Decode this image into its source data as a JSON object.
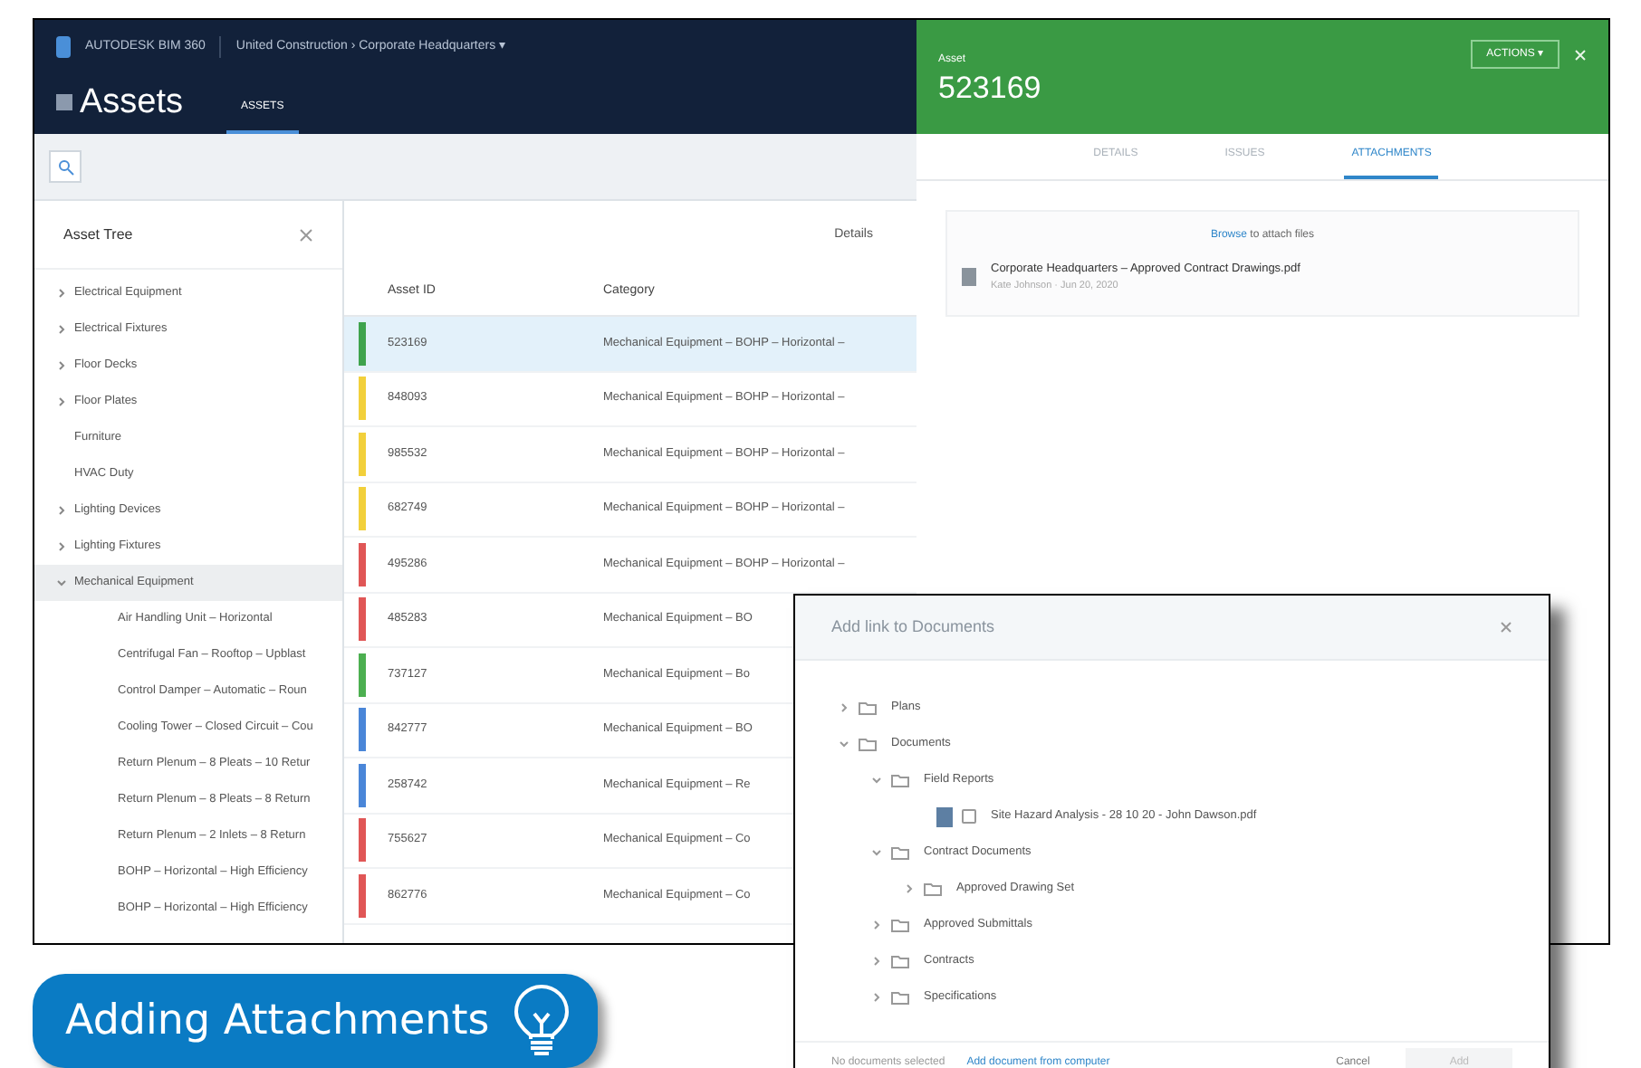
{
  "header": {
    "brand": "AUTODESK BIM 360",
    "breadcrumb": "United Construction › Corporate Headquarters ▾",
    "title": "Assets",
    "tabs": [
      {
        "label": "ASSETS",
        "selected": true
      }
    ]
  },
  "asset_tree": {
    "title": "Asset Tree",
    "items": [
      {
        "label": "Electrical Equipment",
        "expanded": false,
        "selected": false
      },
      {
        "label": "Electrical Fixtures",
        "expanded": false,
        "selected": false
      },
      {
        "label": "Floor Decks",
        "expanded": false,
        "selected": false
      },
      {
        "label": "Floor Plates",
        "expanded": false,
        "selected": false
      },
      {
        "label": "Furniture",
        "selected": false
      },
      {
        "label": "HVAC Duty",
        "selected": false
      },
      {
        "label": "Lighting Devices",
        "expanded": false,
        "selected": false
      },
      {
        "label": "Lighting Fixtures",
        "expanded": false,
        "selected": false
      },
      {
        "label": "Mechanical Equipment",
        "expanded": true,
        "selected": true,
        "children": [
          {
            "label": "Air Handling Unit – Horizontal",
            "selected": false
          },
          {
            "label": "Centrifugal Fan – Rooftop – Upblast",
            "selected": false
          },
          {
            "label": "Control Damper – Automatic – Roun",
            "selected": false
          },
          {
            "label": "Cooling Tower – Closed Circuit – Cou",
            "selected": false
          },
          {
            "label": "Return Plenum – 8 Pleats – 10 Retur",
            "selected": false
          },
          {
            "label": "Return Plenum – 8 Pleats – 8 Return",
            "selected": false
          },
          {
            "label": "Return Plenum – 2 Inlets – 8 Return",
            "selected": false
          },
          {
            "label": "BOHP – Horizontal – High Efficiency",
            "selected": false
          },
          {
            "label": "BOHP – Horizontal – High Efficiency",
            "selected": false
          }
        ]
      }
    ]
  },
  "table": {
    "action": "Details",
    "columns": [
      "Asset ID",
      "Category"
    ],
    "rows": [
      {
        "id": "523169",
        "category": "Mechanical Equipment – BOHP – Horizontal –",
        "color": "#3fa34d",
        "selected": true
      },
      {
        "id": "848093",
        "category": "Mechanical Equipment – BOHP – Horizontal –",
        "color": "#f2d03b",
        "selected": false
      },
      {
        "id": "985532",
        "category": "Mechanical Equipment – BOHP – Horizontal –",
        "color": "#f2d03b",
        "selected": false
      },
      {
        "id": "682749",
        "category": "Mechanical Equipment – BOHP – Horizontal –",
        "color": "#f2d03b",
        "selected": false
      },
      {
        "id": "495286",
        "category": "Mechanical Equipment – BOHP – Horizontal –",
        "color": "#e05656",
        "selected": false
      },
      {
        "id": "485283",
        "category": "Mechanical Equipment – BO",
        "color": "#e05656",
        "selected": false
      },
      {
        "id": "737127",
        "category": "Mechanical Equipment – Bo",
        "color": "#4caf50",
        "selected": false
      },
      {
        "id": "842777",
        "category": "Mechanical Equipment – BO",
        "color": "#4a86d8",
        "selected": false
      },
      {
        "id": "258742",
        "category": "Mechanical Equipment – Re",
        "color": "#4a86d8",
        "selected": false
      },
      {
        "id": "755627",
        "category": "Mechanical Equipment – Co",
        "color": "#e05656",
        "selected": false
      },
      {
        "id": "862776",
        "category": "Mechanical Equipment – Co",
        "color": "#e05656",
        "selected": false
      }
    ]
  },
  "asset_panel": {
    "label": "Asset",
    "asset_id": "523169",
    "action": "ACTIONS ▾",
    "tabs": [
      {
        "label": "DETAILS",
        "selected": false
      },
      {
        "label": "ISSUES",
        "selected": false
      },
      {
        "label": "ATTACHMENTS",
        "selected": true
      }
    ],
    "drop_link": "Browse",
    "drop_text": "to attach files",
    "files": [
      {
        "name": "Corporate Headquarters – Approved Contract Drawings.pdf",
        "meta": "Kate Johnson · Jun 20, 2020"
      }
    ]
  },
  "dialog": {
    "title": "Add link to Documents",
    "items": [
      {
        "label": "Plans",
        "kind": "folder",
        "expanded": false
      },
      {
        "label": "Documents",
        "kind": "folder",
        "expanded": true,
        "children": [
          {
            "label": "Field Reports",
            "kind": "folder",
            "expanded": true,
            "children": [
              {
                "label": "Site Hazard Analysis - 28 10 20 - John Dawson.pdf",
                "kind": "file",
                "checked": false
              }
            ]
          },
          {
            "label": "Contract Documents",
            "kind": "folder",
            "expanded": true,
            "children": [
              {
                "label": "Approved Drawing Set",
                "kind": "folder",
                "expanded": false
              }
            ]
          },
          {
            "label": "Approved Submittals",
            "kind": "folder",
            "expanded": false
          },
          {
            "label": "Contracts",
            "kind": "folder",
            "expanded": false
          },
          {
            "label": "Specifications",
            "kind": "folder",
            "expanded": false
          }
        ]
      }
    ],
    "status": "No documents selected",
    "link": "Add document from computer",
    "buttons": [
      {
        "label": "Cancel",
        "disabled": false
      },
      {
        "label": "Add",
        "disabled": true
      }
    ]
  },
  "tip_button": {
    "label": "Adding Attachments"
  }
}
